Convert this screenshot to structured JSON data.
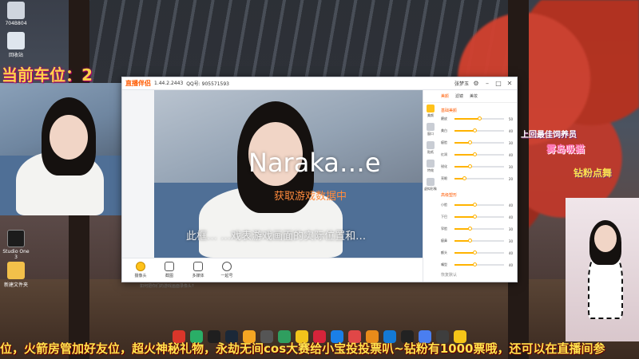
{
  "overlay": {
    "car_position": "当前车位：2",
    "marquee": "位，火箭房管加好友位，超火神秘礼物，永劫无间cos大赛给小宝投投票叭~钻粉有1000票哦，还可以在直播间参"
  },
  "desktop": {
    "icons": [
      {
        "label": "704B804",
        "icon": "computer-icon"
      },
      {
        "label": "回收站",
        "icon": "recycle-bin-icon"
      },
      {
        "label": "Studio One 3",
        "icon": "studio-one-icon"
      },
      {
        "label": "新建文件夹",
        "icon": "folder-icon"
      }
    ]
  },
  "app": {
    "title": "直播伴侣",
    "version": "1.44.2.2443",
    "qq_label": "QQ号: 905571593",
    "user": "张梦玉",
    "preview_game_text": "Naraka…e",
    "fetching_text": "获取游戏数据中",
    "hint_text": "此框…         …戏表游戏画面的实际位置和…",
    "toolbar": [
      {
        "label": "摄像头",
        "icon": "camera-icon"
      },
      {
        "label": "截图",
        "icon": "screenshot-icon"
      },
      {
        "label": "多媒体",
        "icon": "media-icon"
      },
      {
        "label": "一起号",
        "icon": "gamepad-icon"
      }
    ],
    "notice": "如何把你们的游戏画面录像头?",
    "panel": {
      "tabs": [
        "美颜",
        "滤镜",
        "美妆"
      ],
      "active_tab": "美颜",
      "header": "美颜面板",
      "left_items": [
        {
          "label": "美颜",
          "icon": "beauty-icon"
        },
        {
          "label": "窗口",
          "icon": "window-icon"
        },
        {
          "label": "贴纸",
          "icon": "sticker-icon"
        },
        {
          "label": "特效",
          "icon": "effect-icon"
        },
        {
          "label": "虚拟形象",
          "icon": "avatar-icon"
        }
      ],
      "section1": "基础美颜",
      "section2": "高级塑形",
      "section2_tabs": [
        "脸型",
        "眼睛",
        "鼻子",
        "眉毛",
        "嘴巴",
        "全部"
      ],
      "sliders": [
        {
          "label": "磨皮",
          "value": 50
        },
        {
          "label": "美白",
          "value": 40
        },
        {
          "label": "瘦脸",
          "value": 30
        },
        {
          "label": "红润",
          "value": 40
        },
        {
          "label": "锐化",
          "value": 30
        },
        {
          "label": "亮眼",
          "value": 20
        },
        {
          "label": "小脸",
          "value": 40
        },
        {
          "label": "下巴",
          "value": 40
        },
        {
          "label": "窄脸",
          "value": 30
        },
        {
          "label": "瘦鼻",
          "value": 30
        },
        {
          "label": "额头",
          "value": 40
        },
        {
          "label": "嘴型",
          "value": 40
        }
      ],
      "reset": "恢复默认"
    }
  },
  "right_overlay": {
    "gift1": "上回最佳饲养员",
    "gift2": "雾岛吸猫",
    "gift3": "钻粉点舞"
  },
  "colors": {
    "accent": "#ff5a00",
    "slider": "#ffb300",
    "car_text": "#ffd24a",
    "marquee_text": "#ffe44d"
  },
  "taskbar": [
    {
      "icon": "game-icon",
      "color": "#d9362a"
    },
    {
      "icon": "wechat-icon",
      "color": "#2aae67"
    },
    {
      "icon": "qq-icon",
      "color": "#1f1f1f"
    },
    {
      "icon": "steam-icon",
      "color": "#1b2838"
    },
    {
      "icon": "question-icon",
      "color": "#f5a623"
    },
    {
      "icon": "stripes-icon",
      "color": "#555"
    },
    {
      "icon": "obs-icon",
      "color": "#2f9e5f"
    },
    {
      "icon": "eye-icon",
      "color": "#f2c31b"
    },
    {
      "icon": "netease-icon",
      "color": "#d6243a"
    },
    {
      "icon": "kugou-icon",
      "color": "#1a7fe8"
    },
    {
      "icon": "mouse-icon",
      "color": "#e04747"
    },
    {
      "icon": "folder-icon",
      "color": "#e88b1a"
    },
    {
      "icon": "edge-icon",
      "color": "#1479d4"
    },
    {
      "icon": "bilibili-icon",
      "color": "#222"
    },
    {
      "icon": "star-icon",
      "color": "#4a7ef0"
    },
    {
      "icon": "reader-icon",
      "color": "#3e3e3e"
    },
    {
      "icon": "circle-icon",
      "color": "#f5c518"
    }
  ]
}
